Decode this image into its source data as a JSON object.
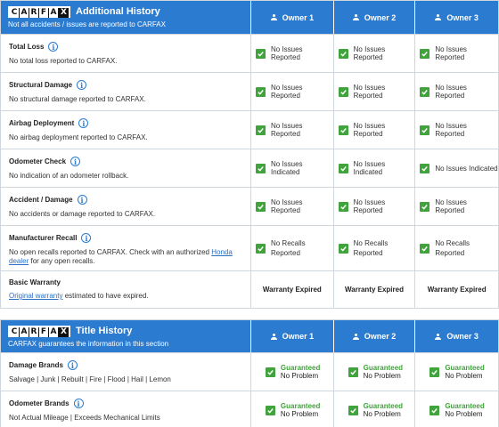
{
  "additional_history": {
    "logo_letters": [
      "C",
      "A",
      "R",
      "F",
      "A",
      "X"
    ],
    "title": "Additional History",
    "subtitle": "Not all accidents / issues are reported to CARFAX",
    "owners": [
      "Owner 1",
      "Owner 2",
      "Owner 3"
    ],
    "rows": [
      {
        "label": "Total Loss",
        "desc": "No total loss reported to CARFAX.",
        "status": [
          "No Issues Reported",
          "No Issues Reported",
          "No Issues Reported"
        ]
      },
      {
        "label": "Structural Damage",
        "desc": "No structural damage reported to CARFAX.",
        "status": [
          "No Issues Reported",
          "No Issues Reported",
          "No Issues Reported"
        ]
      },
      {
        "label": "Airbag Deployment",
        "desc": "No airbag deployment reported to CARFAX.",
        "status": [
          "No Issues Reported",
          "No Issues Reported",
          "No Issues Reported"
        ]
      },
      {
        "label": "Odometer Check",
        "desc": "No indication of an odometer rollback.",
        "status": [
          "No Issues Indicated",
          "No Issues Indicated",
          "No Issues Indicated"
        ]
      },
      {
        "label": "Accident / Damage",
        "desc": "No accidents or damage reported to CARFAX.",
        "status": [
          "No Issues Reported",
          "No Issues Reported",
          "No Issues Reported"
        ]
      },
      {
        "label": "Manufacturer Recall",
        "desc_line1": "No open recalls reported to CARFAX. Check with an authorized ",
        "desc_link": "Honda",
        "desc_link2": "dealer",
        "desc_line2": " for any open recalls.",
        "status_a": [
          "No Recalls",
          "No Recalls",
          "No Recalls"
        ],
        "status_b": [
          "Reported",
          "Reported",
          "Reported"
        ]
      },
      {
        "label": "Basic Warranty",
        "desc_link": "Original warranty",
        "desc_rest": " estimated to have expired.",
        "status": [
          "Warranty Expired",
          "Warranty Expired",
          "Warranty Expired"
        ]
      }
    ]
  },
  "title_history": {
    "logo_letters": [
      "C",
      "A",
      "R",
      "F",
      "A",
      "X"
    ],
    "title": "Title History",
    "subtitle": "CARFAX guarantees the information in this section",
    "owners": [
      "Owner 1",
      "Owner 2",
      "Owner 3"
    ],
    "rows": [
      {
        "label": "Damage Brands",
        "desc": "Salvage | Junk | Rebuilt | Fire | Flood | Hail | Lemon",
        "guaranteed": "Guaranteed",
        "result": "No Problem"
      },
      {
        "label": "Odometer Brands",
        "desc": "Not Actual Mileage | Exceeds Mechanical Limits",
        "guaranteed": "Guaranteed",
        "result": "No Problem"
      }
    ]
  },
  "colors": {
    "header_blue": "#2b7bd0",
    "check_green": "#41a33c",
    "link_blue": "#2b6fc4"
  },
  "icons": [
    "person-icon",
    "info-icon",
    "check-icon"
  ]
}
